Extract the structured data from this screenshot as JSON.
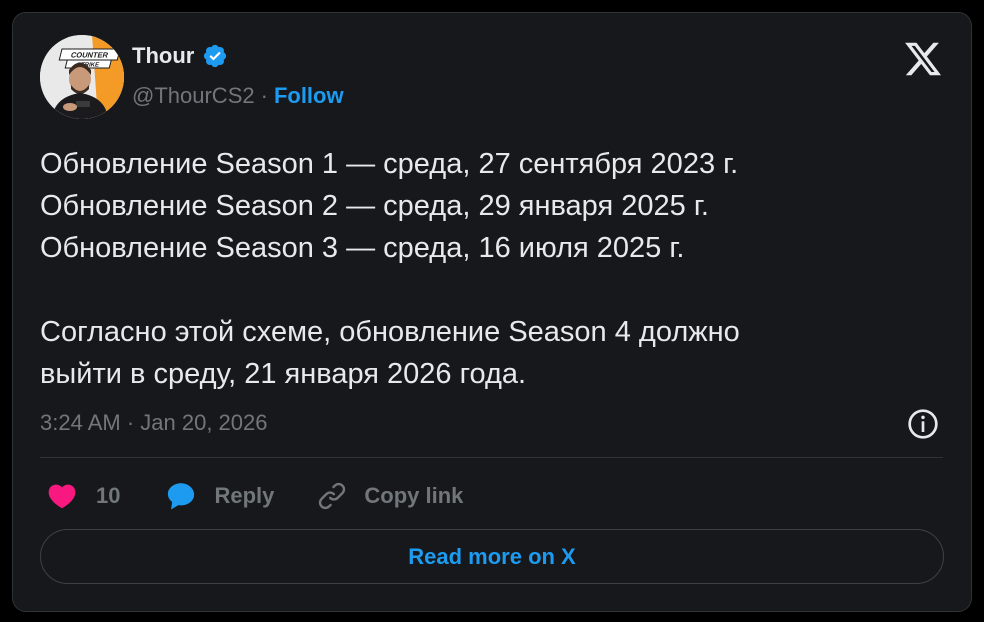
{
  "author": {
    "name": "Thour",
    "handle": "@ThourCS2",
    "separator": "·",
    "follow_label": "Follow",
    "verified": true,
    "avatar_badge_line1": "COUNTER",
    "avatar_badge_line2": "STRIKE"
  },
  "tweet": {
    "lines": [
      "Обновление Season 1 — среда, 27 сентября 2023 г.",
      "Обновление Season 2 — среда, 29 января 2025 г.",
      "Обновление Season 3 — среда, 16 июля 2025 г.",
      "",
      "Согласно этой схеме, обновление Season 4 должно",
      "выйти в среду, 21 января 2026 года."
    ],
    "timestamp": "3:24 AM · Jan 20, 2026"
  },
  "actions": {
    "like_count": "10",
    "reply_label": "Reply",
    "copy_link_label": "Copy link"
  },
  "read_more_label": "Read more on X",
  "icons": {
    "verified": "verified-badge-icon",
    "x_logo": "x-logo-icon",
    "info": "info-icon",
    "heart": "heart-icon",
    "reply": "reply-bubble-icon",
    "link": "link-icon"
  },
  "colors": {
    "background": "#16181c",
    "text": "#e7e9ea",
    "muted": "#71767b",
    "accent": "#1d9bf0",
    "like": "#f91880",
    "border": "#2f3336"
  }
}
